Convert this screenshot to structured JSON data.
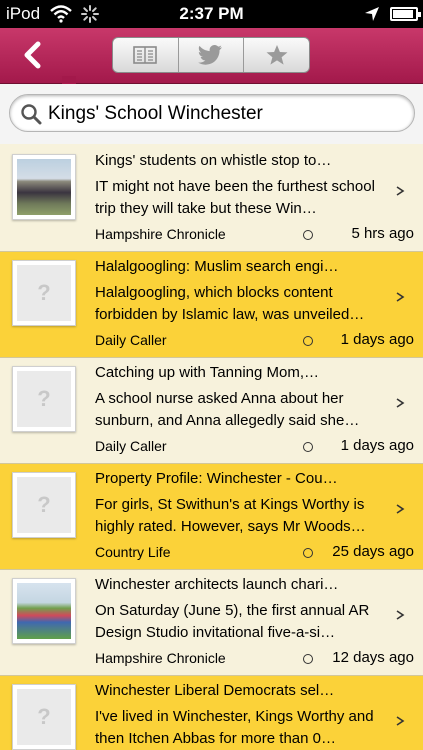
{
  "status_bar": {
    "carrier": "iPod",
    "time": "2:37 PM",
    "battery_level": 0.9
  },
  "nav": {
    "back_icon": "chevron-left-icon",
    "segments": [
      {
        "icon": "book-icon"
      },
      {
        "icon": "twitter-bird-icon"
      },
      {
        "icon": "star-icon"
      }
    ]
  },
  "search": {
    "query": "Kings' School Winchester"
  },
  "colors": {
    "nav": "#b3245a",
    "row_cream": "#f7f2dc",
    "row_yellow": "#fbd239"
  },
  "articles": [
    {
      "title": "Kings' students on whistle stop to…",
      "snippet": "IT might not have been the furthest school trip they will take but these Win…",
      "source": "Hampshire Chronicle",
      "age": "5 hrs ago",
      "thumb": "photo"
    },
    {
      "title": "Halalgoogling: Muslim search engi…",
      "snippet": "Halalgoogling, which blocks content forbidden by Islamic law, was unveiled…",
      "source": "Daily Caller",
      "age": "1 days ago",
      "thumb": "?"
    },
    {
      "title": "Catching up with Tanning Mom,…",
      "snippet": "A school nurse asked Anna about her sunburn, and Anna allegedly said she…",
      "source": "Daily Caller",
      "age": "1 days ago",
      "thumb": "?"
    },
    {
      "title": "Property Profile: Winchester - Cou…",
      "snippet": "For girls, St Swithun's at Kings Worthy is highly rated. However, says Mr Woods…",
      "source": "Country Life",
      "age": "25 days ago",
      "thumb": "?"
    },
    {
      "title": "Winchester architects launch chari…",
      "snippet": "On Saturday (June 5), the first annual AR Design Studio invitational five-a-si…",
      "source": "Hampshire Chronicle",
      "age": "12 days ago",
      "thumb": "photo"
    },
    {
      "title": "Winchester Liberal Democrats sel…",
      "snippet": "I've lived in Winchester, Kings Worthy and then Itchen Abbas for more than 0…",
      "source": "",
      "age": "",
      "thumb": "?"
    }
  ]
}
